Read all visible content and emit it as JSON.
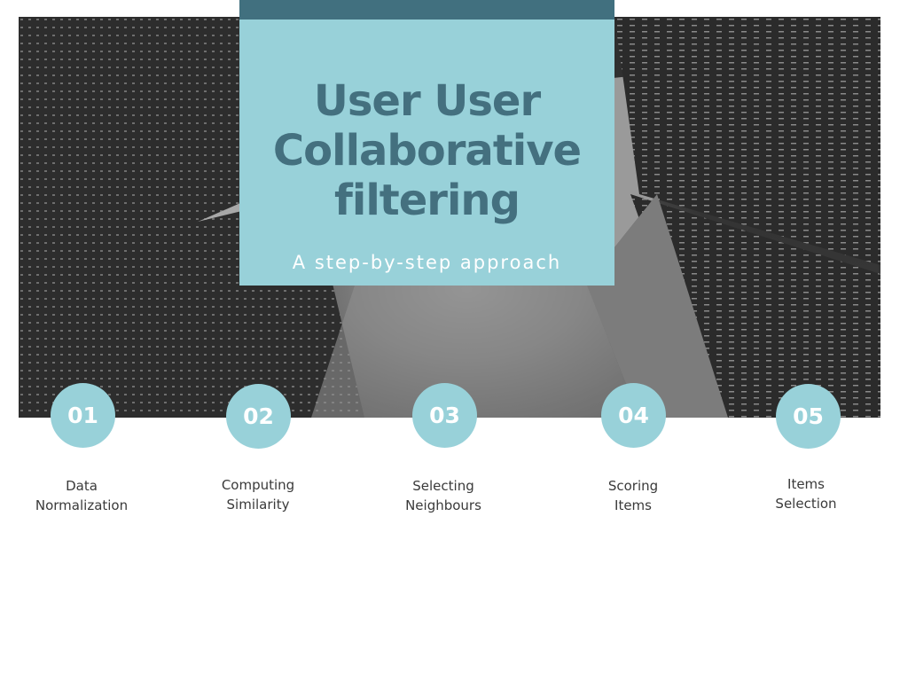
{
  "title": {
    "line1": "User User",
    "line2": "Collaborative",
    "line3": "filtering",
    "subtitle": "A step-by-step approach"
  },
  "steps": [
    {
      "number": "01",
      "label_line1": "Data",
      "label_line2": "Normalization"
    },
    {
      "number": "02",
      "label_line1": "Computing",
      "label_line2": "Similarity"
    },
    {
      "number": "03",
      "label_line1": "Selecting",
      "label_line2": "Neighbours"
    },
    {
      "number": "04",
      "label_line1": "Scoring",
      "label_line2": "Items"
    },
    {
      "number": "05",
      "label_line1": "Items",
      "label_line2": "Selection"
    }
  ],
  "colors": {
    "accent_light": "#98d1d9",
    "accent_dark": "#41707f",
    "label_text": "#3a3a3a"
  }
}
